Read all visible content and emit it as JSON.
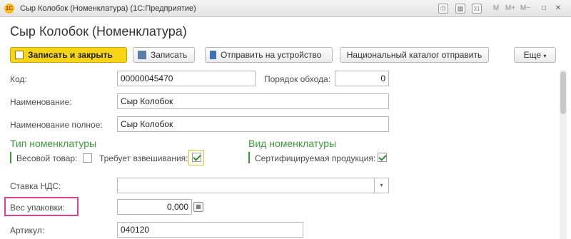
{
  "window": {
    "title": "Сыр Колобок (Номенклатура) (1С:Предприятие)",
    "logo_text": "1С",
    "controls": {
      "m": "M",
      "mplus": "M+",
      "mminus": "M−",
      "restore": "□",
      "close": "✕",
      "calendar_day": "31"
    }
  },
  "form": {
    "title": "Сыр Колобок (Номенклатура)"
  },
  "toolbar": {
    "save_close": "Записать и закрыть",
    "save": "Записать",
    "send_device": "Отправить на устройство",
    "national_catalog": "Национальный каталог отправить",
    "more": "Еще",
    "more_arrow": "▾"
  },
  "fields": {
    "code": {
      "label": "Код:",
      "value": "00000045470"
    },
    "order": {
      "label": "Порядок обхода:",
      "value": "0"
    },
    "name": {
      "label": "Наименование:",
      "value": "Сыр Колобок"
    },
    "full_name": {
      "label": "Наименование полное:",
      "value": "Сыр Колобок"
    },
    "vat": {
      "label": "Ставка НДС:",
      "value": "",
      "arrow": "▾"
    },
    "pack_weight": {
      "label": "Вес упаковки:",
      "value": "0,000"
    },
    "article": {
      "label": "Артикул:",
      "value": "040120"
    }
  },
  "type_group": {
    "title": "Тип номенклатуры",
    "weighted_label": "Весовой товар:",
    "weighted_checked": false,
    "requires_weighing_label": "Требует взвешивания:",
    "requires_weighing_checked": true
  },
  "kind_group": {
    "title": "Вид номенклатуры",
    "certified_label": "Сертифицируемая продукция:",
    "certified_checked": true
  },
  "colors": {
    "accent_green": "#3a9a3a",
    "primary_button": "#f7d416",
    "highlight": "#e0408a"
  }
}
